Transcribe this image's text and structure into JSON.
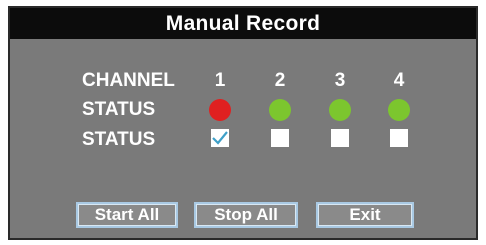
{
  "dialog": {
    "title": "Manual Record"
  },
  "rows": {
    "channel_label": "CHANNEL",
    "status_label_1": "STATUS",
    "status_label_2": "STATUS"
  },
  "channels": [
    {
      "number": "1",
      "status_color": "#e02020",
      "checked": true
    },
    {
      "number": "2",
      "status_color": "#7cc62e",
      "checked": false
    },
    {
      "number": "3",
      "status_color": "#7cc62e",
      "checked": false
    },
    {
      "number": "4",
      "status_color": "#7cc62e",
      "checked": false
    }
  ],
  "buttons": {
    "start_all": "Start All",
    "stop_all": "Stop All",
    "exit": "Exit"
  },
  "colors": {
    "panel_bg": "#7a7a7a",
    "title_bar": "#0c0c0c",
    "button_border": "#a9c9e3",
    "check_mark": "#3fa0c8"
  }
}
